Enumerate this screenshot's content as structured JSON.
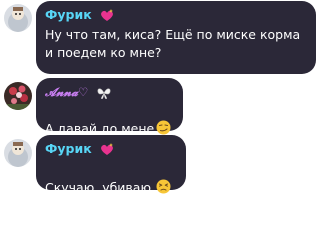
{
  "messages": [
    {
      "sender": "Фурик",
      "sender_icon": "sparkling-heart-icon",
      "text": "Ну что там, киса? Ещё по миске корма\nи поедем ко мне?"
    },
    {
      "sender": "𝓐𝓷𝓷𝓪♡",
      "sender_icon": "butterfly-icon",
      "text": "А давай до мене",
      "emoji": "smirking-face-icon"
    },
    {
      "sender": "Фурик",
      "sender_icon": "sparkling-heart-icon",
      "text": "Скучаю, убиваю",
      "emoji": "persevering-face-icon"
    }
  ],
  "colors": {
    "bubble": "#2b2838",
    "sender_cyan": "#58d6f6",
    "sender_purple": "#c77ef0",
    "heart": "#e8338f",
    "emoji_yellow": "#f7c637"
  }
}
